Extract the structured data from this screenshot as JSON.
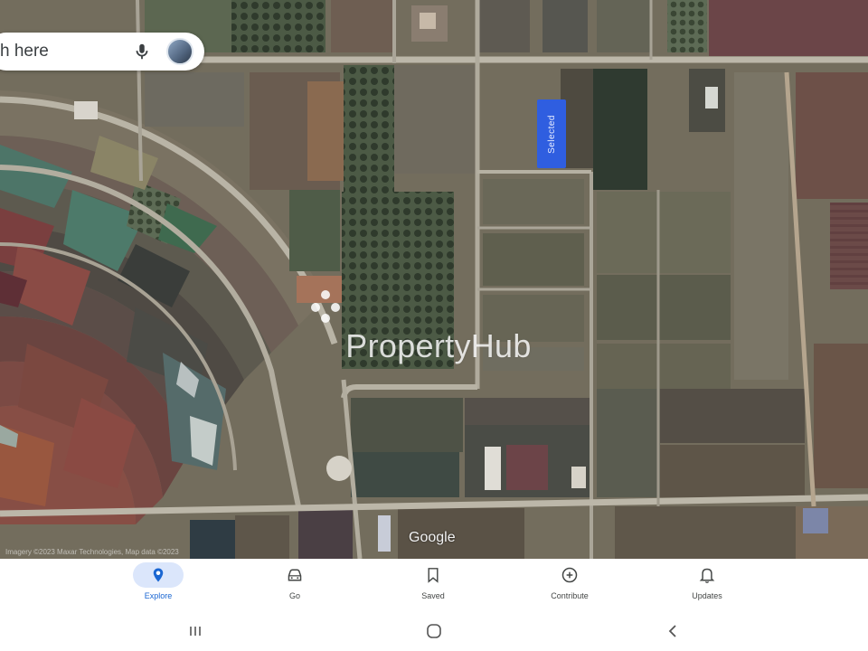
{
  "search": {
    "text": "h here",
    "mic_icon": "mic-icon",
    "avatar_icon": "avatar"
  },
  "map": {
    "pin_label": "Selected",
    "watermark": "PropertyHub",
    "google_logo": "Google",
    "attribution": "Imagery ©2023 Maxar Technologies, Map data ©2023",
    "colors": {
      "pin": "#2f5ee0",
      "road": "#b9b4a6"
    }
  },
  "nav": {
    "active": "explore",
    "items": [
      {
        "key": "explore",
        "label": "Explore",
        "icon": "location-pin-icon"
      },
      {
        "key": "go",
        "label": "Go",
        "icon": "car-icon"
      },
      {
        "key": "saved",
        "label": "Saved",
        "icon": "bookmark-icon"
      },
      {
        "key": "contribute",
        "label": "Contribute",
        "icon": "add-circle-icon"
      },
      {
        "key": "updates",
        "label": "Updates",
        "icon": "bell-icon"
      }
    ]
  },
  "system_nav": {
    "recents": "recents-icon",
    "home": "home-icon",
    "back": "back-icon"
  }
}
